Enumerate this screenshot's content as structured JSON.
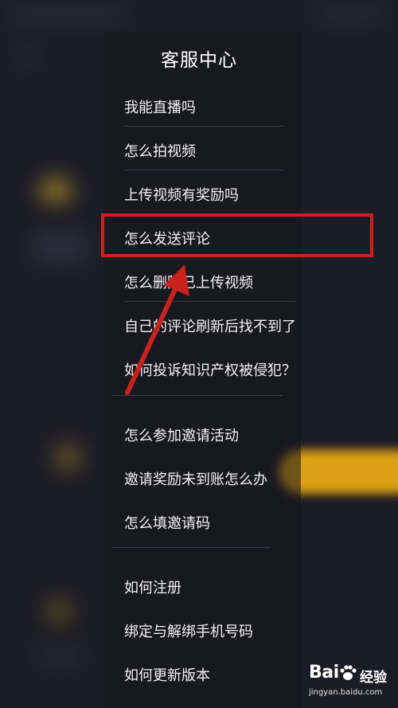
{
  "header": {
    "title": "客服中心"
  },
  "menu": {
    "group1": [
      "我能直播吗",
      "怎么拍视频",
      "上传视频有奖励吗",
      "怎么发送评论",
      "怎么删除已上传视频",
      "自己的评论刷新后找不到了",
      "如何投诉知识产权被侵犯？"
    ],
    "group2": [
      "怎么参加邀请活动",
      "邀请奖励未到账怎么办",
      "怎么填邀请码"
    ],
    "group3": [
      "如何注册",
      "绑定与解绑手机号码",
      "如何更新版本"
    ]
  },
  "annotation": {
    "highlight_color": "#c9221c",
    "highlighted_item": "怎么发送评论"
  },
  "watermark": {
    "logo": "Bai",
    "brand": "经验",
    "url": "jingyan.baidu.com"
  },
  "colors": {
    "background": "#1c1c26",
    "accent_yellow": "#e8a712"
  }
}
